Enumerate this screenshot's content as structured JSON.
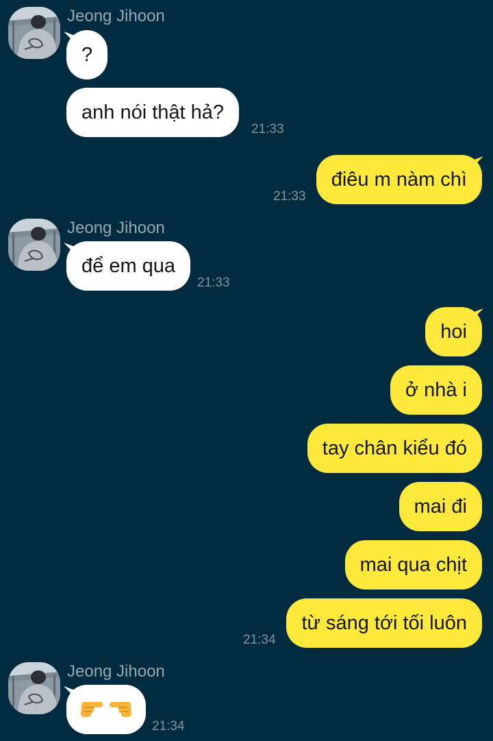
{
  "colors": {
    "background": "#022b40",
    "incoming_bubble": "#ffffff",
    "outgoing_bubble": "#fde93c",
    "sender_name": "#9aa8b3",
    "timestamp": "#8594a0"
  },
  "messages": [
    {
      "sender": "Jeong Jihoon",
      "text": "?",
      "time": ""
    },
    {
      "text": "anh nói thật hả?",
      "time": "21:33"
    },
    {
      "text": "điêu m nàm chì",
      "time": "21:33"
    },
    {
      "sender": "Jeong Jihoon",
      "text": "để em qua",
      "time": "21:33"
    },
    {
      "text": "hoi"
    },
    {
      "text": "ở nhà i"
    },
    {
      "text": "tay chân kiểu đó"
    },
    {
      "text": "mai đi"
    },
    {
      "text": "mai qua chịt"
    },
    {
      "text": "từ sáng tới tối luôn",
      "time": "21:34"
    },
    {
      "sender": "Jeong Jihoon",
      "emoji": [
        "backhand-index-pointing-right",
        "backhand-index-pointing-left"
      ],
      "time": "21:34"
    }
  ]
}
